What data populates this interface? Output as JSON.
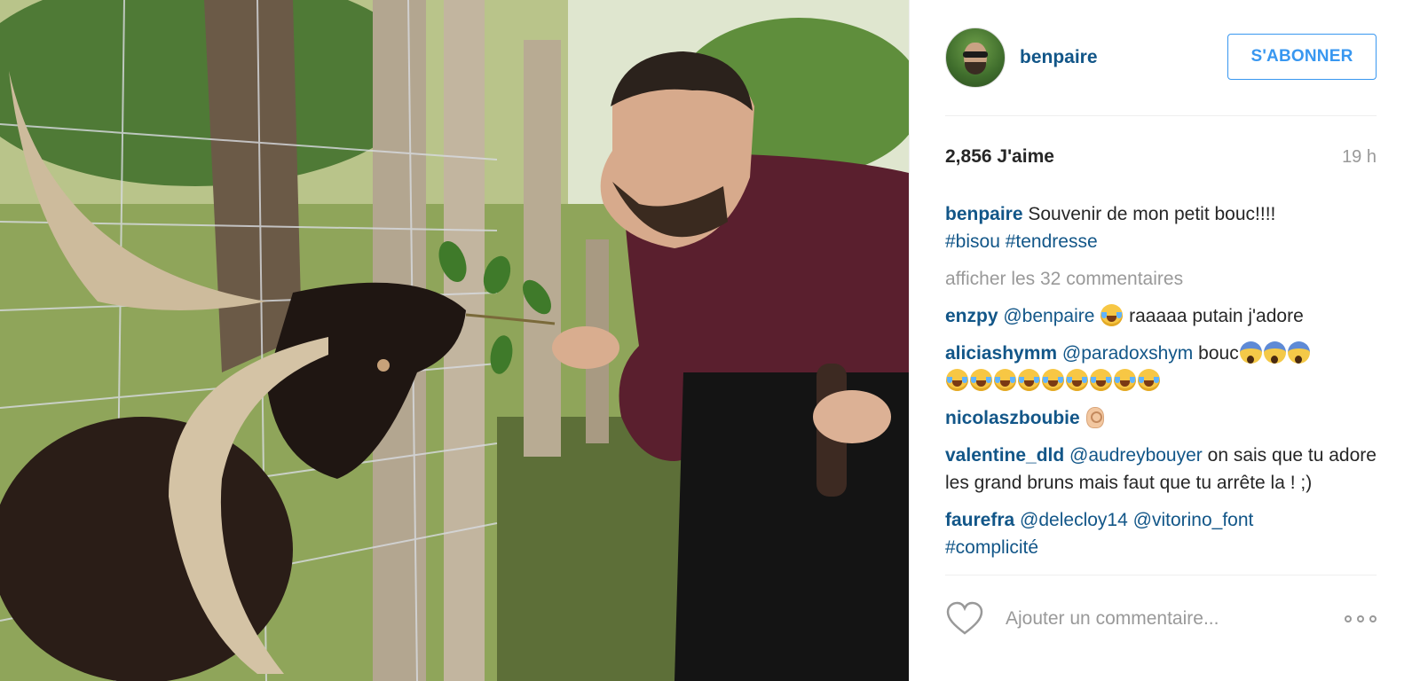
{
  "post": {
    "photo_alt": "",
    "header": {
      "username": "benpaire",
      "follow_label": "S'ABONNER"
    },
    "stats": {
      "likes": "2,856 J'aime",
      "time": "19 h"
    },
    "caption": {
      "username": "benpaire",
      "text": "Souvenir de mon petit bouc!!!!",
      "tags": [
        "#bisou",
        "#tendresse"
      ]
    },
    "more_comments": "afficher les 32 commentaires",
    "comments": [
      {
        "user": "enzpy",
        "mention": "@benpaire",
        "text_after": "raaaaa putain j'adore",
        "emoji_before_text": "face-with-tears-of-joy"
      },
      {
        "user": "aliciashymm",
        "mention": "@paradoxshym",
        "text_after": "bouc",
        "emoji_after": [
          "face-screaming-in-fear",
          "face-screaming-in-fear",
          "face-screaming-in-fear"
        ],
        "emoji_line2": [
          "face-with-tears-of-joy",
          "face-with-tears-of-joy",
          "face-with-tears-of-joy",
          "face-with-tears-of-joy",
          "face-with-tears-of-joy",
          "face-with-tears-of-joy",
          "face-with-tears-of-joy",
          "face-with-tears-of-joy",
          "face-with-tears-of-joy"
        ]
      },
      {
        "user": "nicolaszboubie",
        "emoji_after": [
          "ok-hand"
        ]
      },
      {
        "user": "valentine_dld",
        "mention": "@audreybouyer",
        "text_after": "on sais que tu adore les grand bruns mais faut que tu arrête la ! ;)"
      },
      {
        "user": "faurefra",
        "mention": "@delecloy14",
        "mention2": "@vitorino_font",
        "text_after": "#complicité"
      }
    ],
    "footer": {
      "like_icon": "heart-outline-icon",
      "comment_placeholder": "Ajouter un commentaire...",
      "more_icon": "more-options-icon"
    }
  }
}
